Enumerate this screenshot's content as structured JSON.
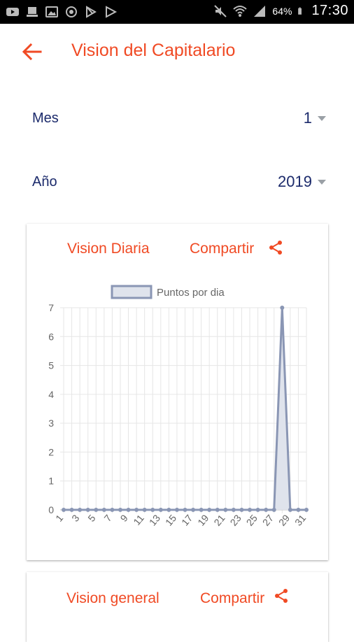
{
  "status_bar": {
    "icons": [
      "youtube-icon",
      "laptop-icon",
      "image-icon",
      "sync-icon",
      "play-store-icon",
      "play-icon"
    ],
    "right_icons": [
      "mute-icon",
      "wifi-icon",
      "signal-icon"
    ],
    "battery": "64%",
    "time": "17:30"
  },
  "app_bar": {
    "title": "Vision del Capitalario",
    "back_icon": "arrow-back-icon",
    "accent": "#f04a24"
  },
  "filters": {
    "mes": {
      "label": "Mes",
      "value": "1"
    },
    "anio": {
      "label": "Año",
      "value": "2019"
    }
  },
  "card_daily": {
    "title": "Vision Diaria",
    "share_label": "Compartir",
    "share_icon": "share-icon"
  },
  "card_general": {
    "title": "Vision general",
    "share_label": "Compartir",
    "share_icon": "share-icon"
  },
  "chart_data": {
    "type": "area",
    "legend": "Puntos por dia",
    "legend_position": "top",
    "x": [
      1,
      2,
      3,
      4,
      5,
      6,
      7,
      8,
      9,
      10,
      11,
      12,
      13,
      14,
      15,
      16,
      17,
      18,
      19,
      20,
      21,
      22,
      23,
      24,
      25,
      26,
      27,
      28,
      29,
      30,
      31
    ],
    "x_tick_labels": [
      "1",
      "3",
      "5",
      "7",
      "9",
      "11",
      "13",
      "15",
      "17",
      "19",
      "21",
      "23",
      "25",
      "27",
      "29",
      "31"
    ],
    "values": [
      0,
      0,
      0,
      0,
      0,
      0,
      0,
      0,
      0,
      0,
      0,
      0,
      0,
      0,
      0,
      0,
      0,
      0,
      0,
      0,
      0,
      0,
      0,
      0,
      0,
      0,
      0,
      7,
      0,
      0,
      0
    ],
    "ylim": [
      0,
      7
    ],
    "y_ticks": [
      0,
      1,
      2,
      3,
      4,
      5,
      6,
      7
    ],
    "grid": true,
    "colors": {
      "line": "#8a96b4",
      "fill": "#dfe3ec",
      "grid": "#e6e6e6"
    }
  }
}
